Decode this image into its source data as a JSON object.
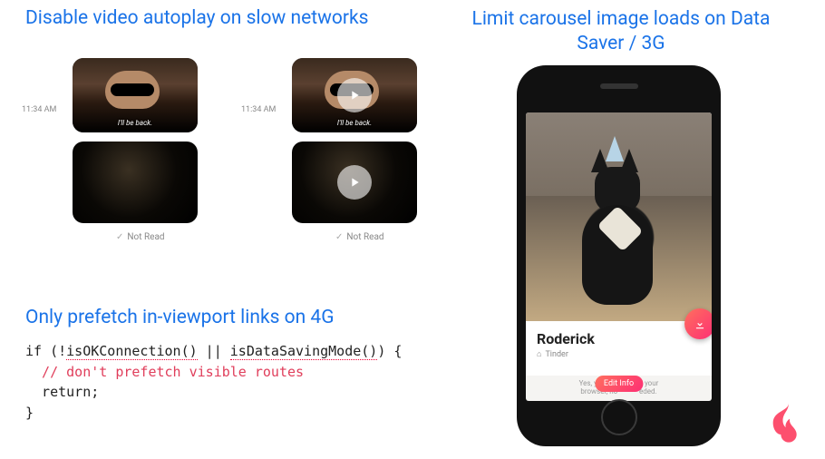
{
  "headings": {
    "autoplay": "Disable video autoplay on slow networks",
    "carousel": "Limit carousel image loads on Data Saver / 3G",
    "prefetch": "Only prefetch in-viewport links on 4G"
  },
  "chat": {
    "timestamp": "11:34 AM",
    "caption": "I'll be back.",
    "read_status": "Not Read"
  },
  "code": {
    "line1_pre": "if (!",
    "cond1": "isOKConnection()",
    "line1_mid": " || ",
    "cond2": "isDataSavingMode()",
    "line1_post": ") {",
    "comment": "  // don't prefetch visible routes",
    "return_kw": "  return",
    "semicolon": ";",
    "close": "}"
  },
  "phone": {
    "name": "Roderick",
    "sub_label": "Tinder",
    "hint_left": "Yes, you can",
    "hint_right": "in your",
    "hint_line2_left": "browser, no",
    "hint_line2_right": "eded.",
    "edit_label": "Edit Info"
  }
}
